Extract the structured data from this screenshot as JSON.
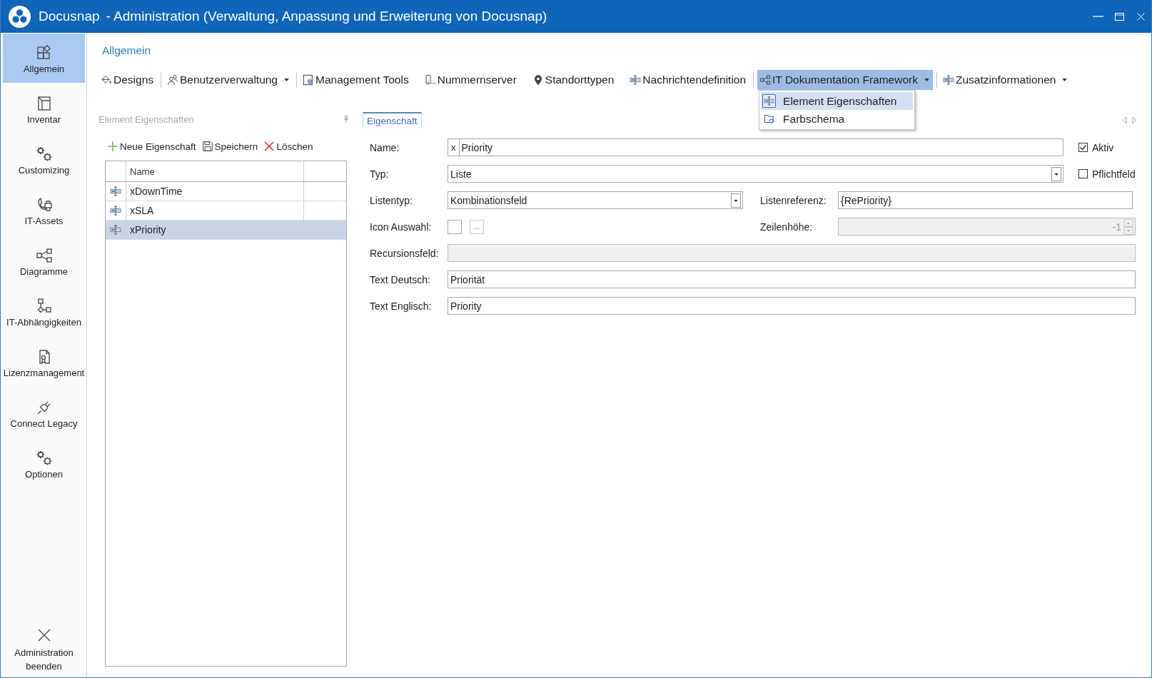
{
  "window": {
    "app_name": "Docusnap",
    "title": "- Administration (Verwaltung, Anpassung und Erweiterung von Docusnap)"
  },
  "sidebar": {
    "items": [
      {
        "label": "Allgemein",
        "selected": true
      },
      {
        "label": "Inventar",
        "selected": false
      },
      {
        "label": "Customizing",
        "selected": false
      },
      {
        "label": "IT-Assets",
        "selected": false
      },
      {
        "label": "Diagramme",
        "selected": false
      },
      {
        "label": "IT-Abhängigkeiten",
        "selected": false
      },
      {
        "label": "Lizenzmanagement",
        "selected": false
      },
      {
        "label": "Connect Legacy",
        "selected": false
      },
      {
        "label": "Optionen",
        "selected": false
      }
    ],
    "exit_button": {
      "label": "Administration beenden"
    }
  },
  "ribbon": {
    "title": "Allgemein",
    "groups": [
      {
        "items": [
          {
            "label": "Designs",
            "dropdown": false,
            "expanded": false
          }
        ]
      },
      {
        "items": [
          {
            "label": "Benutzerverwaltung",
            "dropdown": true,
            "expanded": false
          }
        ]
      },
      {
        "items": [
          {
            "label": "Management Tools",
            "dropdown": false,
            "expanded": false
          },
          {
            "label": "Nummernserver",
            "dropdown": false,
            "expanded": false
          },
          {
            "label": "Standorttypen",
            "dropdown": false,
            "expanded": false
          },
          {
            "label": "Nachrichtendefinition",
            "dropdown": false,
            "expanded": false
          }
        ]
      },
      {
        "items": [
          {
            "label": "IT Dokumentation Framework",
            "dropdown": true,
            "expanded": true,
            "menu": [
              {
                "label": "Element Eigenschaften",
                "selected": true
              },
              {
                "label": "Farbschema",
                "selected": false
              }
            ]
          }
        ]
      },
      {
        "items": [
          {
            "label": "Zusatzinformationen",
            "dropdown": true,
            "expanded": false
          }
        ]
      }
    ]
  },
  "element_panel": {
    "title": "Element Eigenschaften",
    "actions": [
      {
        "label": "Neue Eigenschaft"
      },
      {
        "label": "Speichern"
      },
      {
        "label": "Löschen"
      }
    ],
    "table": {
      "columns": [
        "Name"
      ],
      "rows": [
        {
          "name": "xDownTime",
          "selected": false
        },
        {
          "name": "xSLA",
          "selected": false
        },
        {
          "name": "xPriority",
          "selected": true
        }
      ]
    }
  },
  "detail_panel": {
    "tabs": [
      {
        "label": "Eigenschaft",
        "selected": true
      }
    ],
    "form": {
      "name": {
        "label": "Name:",
        "prefix": "x",
        "value": "Priority"
      },
      "aktiv": {
        "label": "Aktiv",
        "checked": true
      },
      "typ": {
        "label": "Typ:",
        "value": "Liste"
      },
      "pflichtfeld": {
        "label": "Pflichtfeld",
        "checked": false
      },
      "listentyp": {
        "label": "Listentyp:",
        "value": "Kombinationsfeld"
      },
      "listenreferenz": {
        "label": "Listenreferenz:",
        "value": "{RePriority}"
      },
      "icon_auswahl": {
        "label": "Icon Auswahl:",
        "button": "..."
      },
      "zeilenhoehe": {
        "label": "Zeilenhöhe:",
        "value": "-1",
        "disabled": true
      },
      "recursionsfeld": {
        "label": "Recursionsfeld:",
        "disabled": true
      },
      "text_deutsch": {
        "label": "Text Deutsch:",
        "value": "Priorität"
      },
      "text_englisch": {
        "label": "Text Englisch:",
        "value": "Priority"
      }
    }
  }
}
